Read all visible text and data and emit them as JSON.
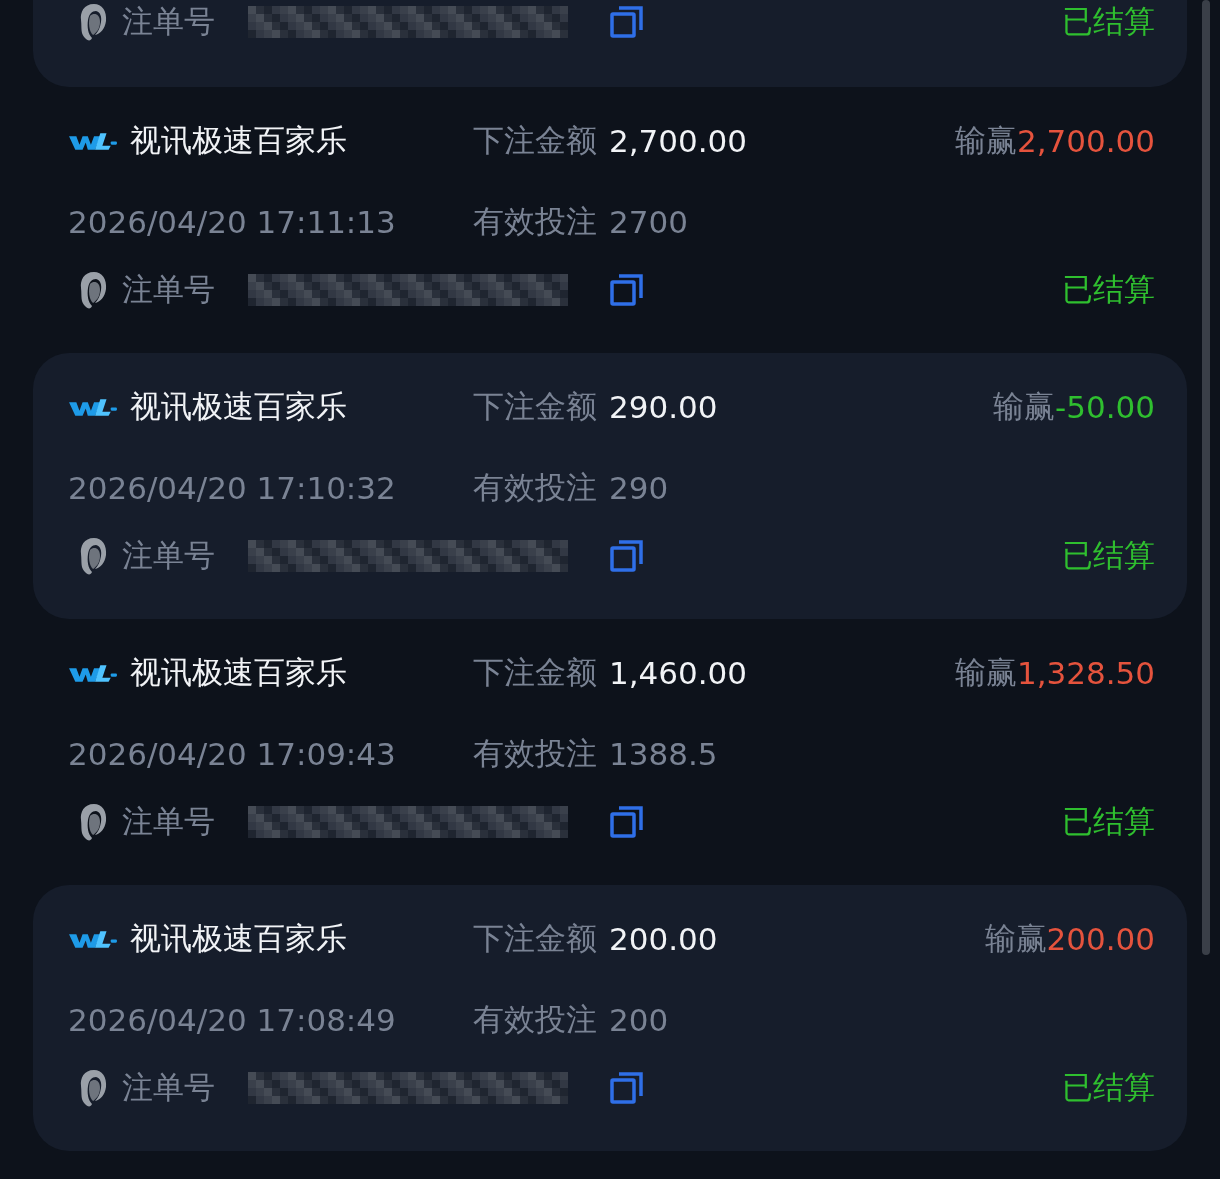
{
  "bets": [
    {
      "highlighted": true,
      "order_label": "注单号",
      "status": "已结算"
    },
    {
      "highlighted": false,
      "game": "视讯极速百家乐",
      "stake_label": "下注金额",
      "stake": "2,700.00",
      "result_label": "输赢",
      "result": "2,700.00",
      "color": "#e5533d",
      "time": "2026/04/20 17:11:13",
      "valid_label": "有效投注",
      "valid": "2700",
      "order_label": "注单号",
      "status": "已结算"
    },
    {
      "highlighted": true,
      "game": "视讯极速百家乐",
      "stake_label": "下注金额",
      "stake": "290.00",
      "result_label": "输赢",
      "result": "-50.00",
      "color": "#2fbf2f",
      "time": "2026/04/20 17:10:32",
      "valid_label": "有效投注",
      "valid": "290",
      "order_label": "注单号",
      "status": "已结算"
    },
    {
      "highlighted": false,
      "game": "视讯极速百家乐",
      "stake_label": "下注金额",
      "stake": "1,460.00",
      "result_label": "输赢",
      "result": "1,328.50",
      "color": "#e5533d",
      "time": "2026/04/20 17:09:43",
      "valid_label": "有效投注",
      "valid": "1388.5",
      "order_label": "注单号",
      "status": "已结算"
    },
    {
      "highlighted": true,
      "game": "视讯极速百家乐",
      "stake_label": "下注金额",
      "stake": "200.00",
      "result_label": "输赢",
      "result": "200.00",
      "color": "#e5533d",
      "time": "2026/04/20 17:08:49",
      "valid_label": "有效投注",
      "valid": "200",
      "order_label": "注单号",
      "status": "已结算"
    }
  ]
}
